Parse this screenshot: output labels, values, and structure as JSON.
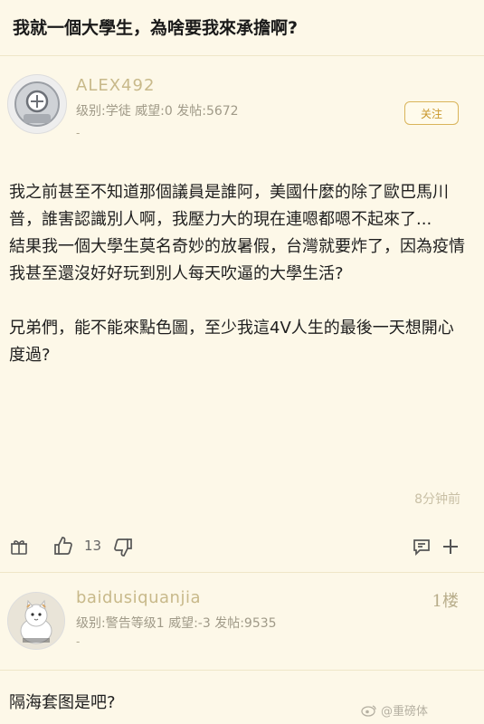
{
  "thread": {
    "title": "我就一個大學生，為啥要我來承擔啊?"
  },
  "post": {
    "author": {
      "name": "ALEX492",
      "meta": "级别:学徒 威望:0 发帖:5672",
      "dash": "-",
      "follow_label": "关注"
    },
    "paragraphs": [
      "我之前甚至不知道那個議員是誰阿，美國什麼的除了歐巴馬川普，誰害認識別人啊，我壓力大的現在連嗯都嗯不起來了...",
      "結果我一個大學生莫名奇妙的放暑假，台灣就要炸了，因為疫情我甚至還沒好好玩到別人每天吹逼的大學生活?",
      "兄弟們，能不能來點色圖，至少我這4V人生的最後一天想開心度過?"
    ],
    "time": "8分钟前",
    "likes": "13",
    "icons": [
      "gift-icon",
      "thumbs-up-icon",
      "thumbs-down-icon",
      "comment-icon",
      "plus-icon"
    ]
  },
  "reply": {
    "author": {
      "name": "baidusiquanjia",
      "meta": "级别:警告等级1 威望:-3 发帖:9535",
      "dash": "-"
    },
    "floor": "1楼",
    "text": "隔海套图是吧?"
  },
  "watermark": "@重磅体"
}
